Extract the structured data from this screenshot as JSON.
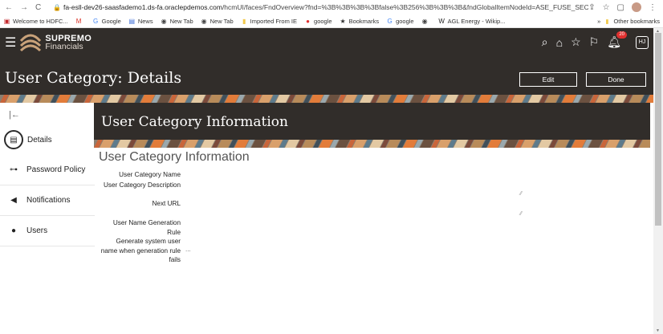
{
  "browser": {
    "nav_icons": [
      "←",
      "→",
      "C"
    ],
    "url_host": "fa-esll-dev26-saasfademo1.ds-fa.oraclepdemos.com",
    "url_path": "/hcmUI/faces/FndOverview?fnd=%3B%3B%3B%3Bfalse%3B256%3B%3B%3B&fndGlobalItemNodeId=ASE_FUSE_SEC...",
    "bookmarks": [
      {
        "icon": "hdfc-icon",
        "glyph": "▣",
        "color": "#c3272b",
        "label": "Welcome to HDFC..."
      },
      {
        "icon": "gmail-icon",
        "glyph": "M",
        "color": "#d93025",
        "label": ""
      },
      {
        "icon": "google-icon",
        "glyph": "G",
        "color": "#4285f4",
        "label": "Google"
      },
      {
        "icon": "news-icon",
        "glyph": "▤",
        "color": "#3b6bd6",
        "label": "News"
      },
      {
        "icon": "globe-icon",
        "glyph": "◉",
        "color": "#444",
        "label": "New Tab"
      },
      {
        "icon": "globe-icon",
        "glyph": "◉",
        "color": "#444",
        "label": "New Tab"
      },
      {
        "icon": "folder-icon",
        "glyph": "▮",
        "color": "#f2c94c",
        "label": "Imported From IE"
      },
      {
        "icon": "google-red-icon",
        "glyph": "●",
        "color": "#e0302f",
        "label": "google"
      },
      {
        "icon": "star-icon",
        "glyph": "★",
        "color": "#333",
        "label": "Bookmarks"
      },
      {
        "icon": "google-icon",
        "glyph": "G",
        "color": "#4285f4",
        "label": "google"
      },
      {
        "icon": "globe-icon",
        "glyph": "◉",
        "color": "#444",
        "label": ""
      },
      {
        "icon": "wikipedia-icon",
        "glyph": "W",
        "color": "#222",
        "label": "AGL Energy - Wikip..."
      }
    ],
    "overflow": "»",
    "other_bookmarks": "Other bookmarks"
  },
  "header": {
    "brand_name": "SUPREMO",
    "brand_sub": "Financials",
    "notification_count": "20",
    "avatar": "HJ",
    "page_title": "User Category: Details",
    "edit_label": "Edit",
    "done_label": "Done"
  },
  "sidebar": {
    "items": [
      {
        "label": "Details",
        "icon": "details-icon"
      },
      {
        "label": "Password Policy",
        "icon": "key-icon"
      },
      {
        "label": "Notifications",
        "icon": "megaphone-icon"
      },
      {
        "label": "Users",
        "icon": "user-icon"
      }
    ]
  },
  "main": {
    "banner_title": "User Category Information",
    "section_title": "User Category Information",
    "fields": [
      {
        "label": "User Category Name",
        "value": ""
      },
      {
        "label": "User Category Description",
        "value": ""
      },
      {
        "label": "Next URL",
        "value": ""
      },
      {
        "label": "User Name Generation Rule",
        "value": ""
      },
      {
        "label": "Generate system user name when generation rule fails",
        "value": "..."
      }
    ]
  },
  "colors": {
    "header_bg": "#312d2a",
    "accent": "#e27c3a"
  }
}
